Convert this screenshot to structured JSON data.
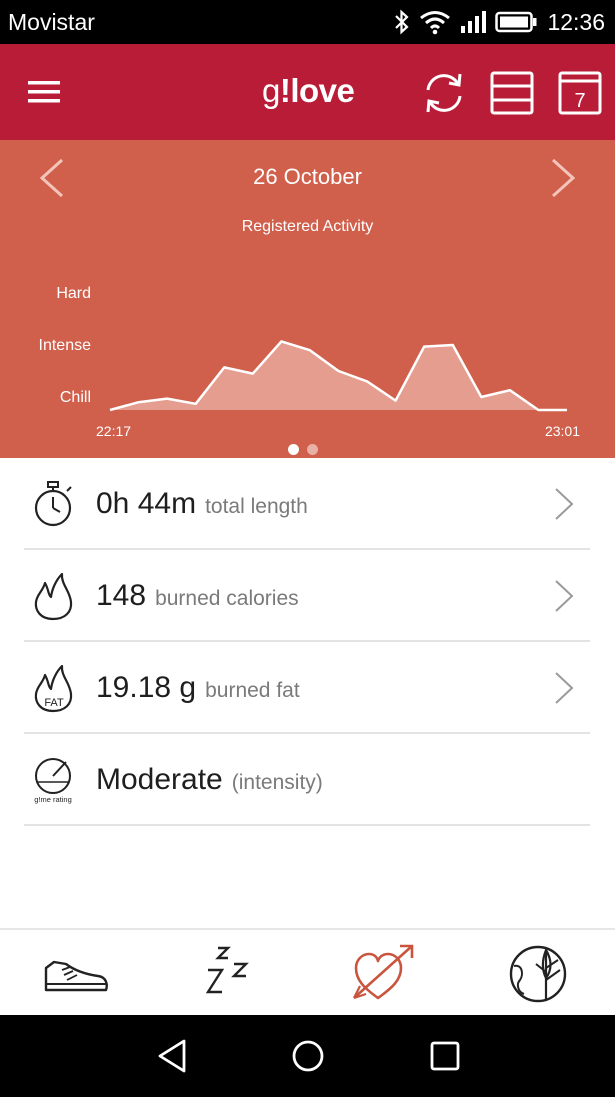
{
  "status_bar": {
    "carrier": "Movistar",
    "time": "12:36",
    "icons": [
      "bluetooth-icon",
      "wifi-icon",
      "signal-icon",
      "battery-icon"
    ]
  },
  "header": {
    "logo_prefix": "g",
    "logo_excl": "!",
    "logo_bold": "love",
    "icons": [
      "menu-icon",
      "sync-icon",
      "list-view-icon",
      "calendar-icon"
    ],
    "calendar_day": "7",
    "brand_color": "#b81c37"
  },
  "activity": {
    "date": "26 October",
    "subtitle": "Registered Activity",
    "background_color": "#d0604c",
    "page_indicator": {
      "pages": 2,
      "active": 0
    }
  },
  "chart_data": {
    "type": "area",
    "title": "Registered Activity",
    "y_categories": [
      "Chill",
      "Intense",
      "Hard"
    ],
    "x_start_label": "22:17",
    "x_end_label": "23:01",
    "x": [
      0,
      1,
      2,
      3,
      4,
      5,
      6,
      7,
      8,
      9,
      10,
      11,
      12,
      13,
      14,
      15,
      16
    ],
    "values": [
      0.0,
      0.15,
      0.22,
      0.12,
      0.82,
      0.7,
      1.32,
      1.15,
      0.75,
      0.55,
      0.18,
      1.22,
      1.25,
      0.25,
      0.38,
      0.0,
      0.0
    ],
    "ylim": [
      0,
      2
    ],
    "grid": false,
    "fill_color": "#e9a89c",
    "line_color": "#ffffff"
  },
  "stats": [
    {
      "icon": "stopwatch-icon",
      "value": "0h 44m",
      "label": "total length",
      "has_chevron": true
    },
    {
      "icon": "flame-icon",
      "value": "148",
      "label": "burned calories",
      "has_chevron": true
    },
    {
      "icon": "fat-flame-icon",
      "icon_text": "FAT",
      "value": "19.18 g",
      "label": "burned fat",
      "has_chevron": true
    },
    {
      "icon": "gauge-icon",
      "icon_text": "g!me rating",
      "value": "Moderate",
      "label": "(intensity)",
      "has_chevron": false
    }
  ],
  "tabs": [
    {
      "icon": "sneaker-icon",
      "active": false
    },
    {
      "icon": "sleep-icon",
      "active": false
    },
    {
      "icon": "heart-arrow-icon",
      "active": true
    },
    {
      "icon": "globe-leaf-icon",
      "active": false
    }
  ],
  "tab_active_color": "#c9553f",
  "system_nav": [
    "back-icon",
    "home-icon",
    "recents-icon"
  ]
}
